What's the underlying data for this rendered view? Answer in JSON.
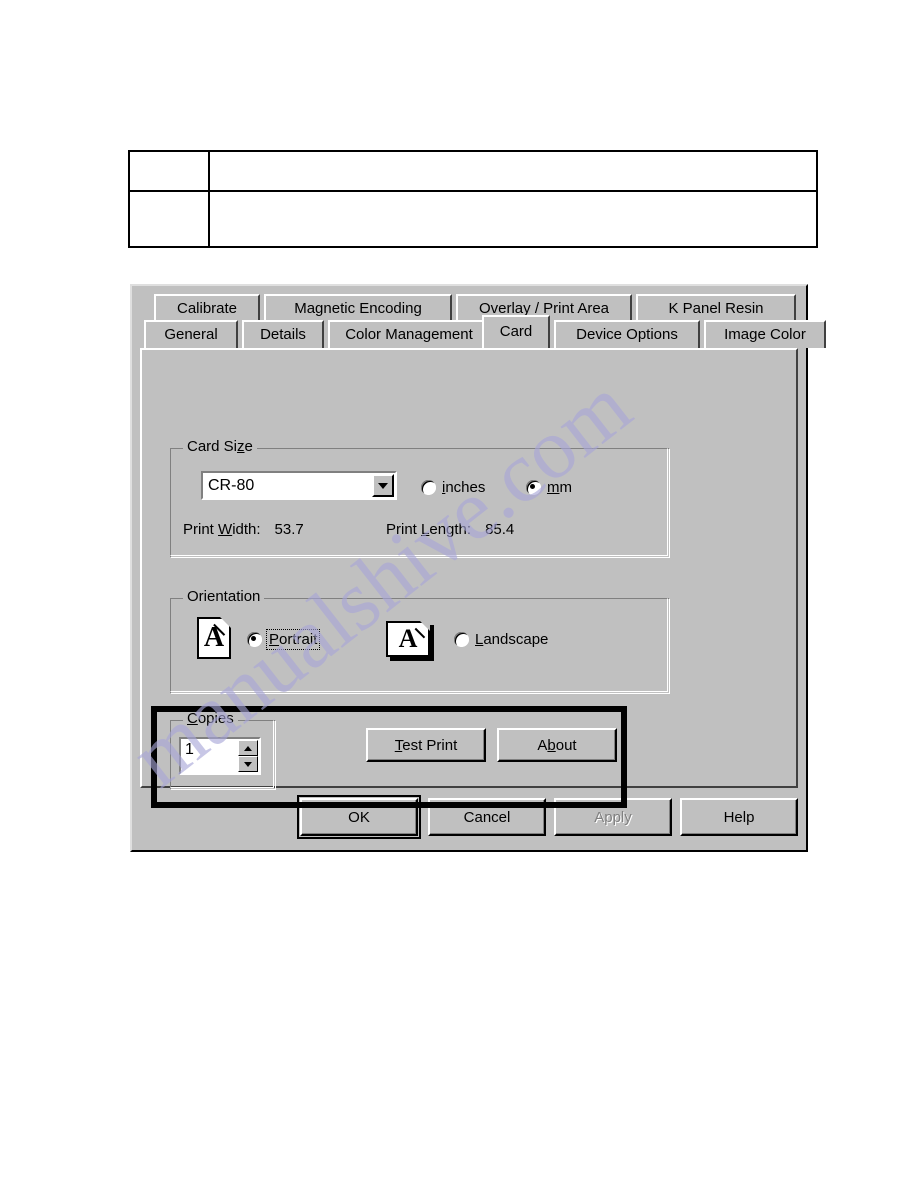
{
  "document_table": {
    "rows": [
      {
        "cells": [
          "",
          ""
        ]
      },
      {
        "cells": [
          "",
          ""
        ]
      }
    ]
  },
  "watermark": {
    "text": "manualshive.com",
    "color": "#a8a6d8"
  },
  "dialog": {
    "background_color": "#c0c0c0",
    "tabs_row1": [
      {
        "label": "Calibrate",
        "selected": false
      },
      {
        "label": "Magnetic Encoding",
        "selected": false
      },
      {
        "label": "Overlay / Print Area",
        "selected": false
      },
      {
        "label": "K Panel Resin",
        "selected": false
      }
    ],
    "tabs_row2": [
      {
        "label": "General",
        "selected": false
      },
      {
        "label": "Details",
        "selected": false
      },
      {
        "label": "Color Management",
        "selected": false
      },
      {
        "label": "Card",
        "selected": true
      },
      {
        "label": "Device Options",
        "selected": false
      },
      {
        "label": "Image Color",
        "selected": false
      }
    ],
    "card_size": {
      "group_title": "Card Size",
      "combo_value": "CR-80",
      "combo_arrow_icon": "chevron-down-icon",
      "units": [
        {
          "label": "inches",
          "selected": false
        },
        {
          "label": "mm",
          "selected": true
        }
      ],
      "print_width_label": "Print Width:",
      "print_width_value": "53.7",
      "print_length_label": "Print Length:",
      "print_length_value": "85.4"
    },
    "orientation": {
      "group_title": "Orientation",
      "portrait": {
        "label": "Portrait",
        "selected": true,
        "focused": true,
        "icon": "portrait-page-icon",
        "icon_glyph": "A"
      },
      "landscape": {
        "label": "Landscape",
        "selected": false,
        "focused": false,
        "icon": "landscape-page-icon",
        "icon_glyph": "A"
      }
    },
    "copies": {
      "group_title": "Copies",
      "value": "1",
      "up_icon": "spinner-up-icon",
      "down_icon": "spinner-down-icon"
    },
    "actions": {
      "test_print": "Test Print",
      "about": "About"
    },
    "command_buttons": [
      {
        "label": "OK",
        "enabled": true,
        "default": true
      },
      {
        "label": "Cancel",
        "enabled": true,
        "default": false
      },
      {
        "label": "Apply",
        "enabled": false,
        "default": false
      },
      {
        "label": "Help",
        "enabled": true,
        "default": false
      }
    ]
  }
}
